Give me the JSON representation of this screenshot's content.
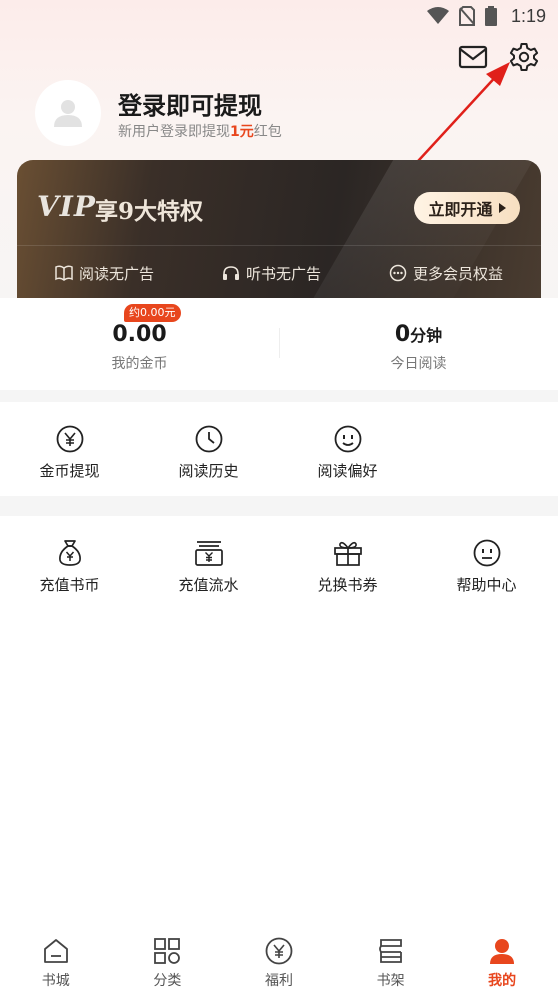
{
  "status_bar": {
    "time": "1:19",
    "icons": [
      "wifi-icon",
      "no-sim-icon",
      "battery-icon"
    ]
  },
  "header": {
    "icons": [
      "mail-icon",
      "settings-icon"
    ]
  },
  "profile": {
    "title": "登录即可提现",
    "subtitle_prefix": "新用户登录即提现",
    "subtitle_highlight": "1元",
    "subtitle_suffix": "红包"
  },
  "vip": {
    "logo": "VIP",
    "title": "享9大特权",
    "button_label": "立即开通",
    "benefits": [
      {
        "icon": "book-icon",
        "label": "阅读无广告"
      },
      {
        "icon": "headphones-icon",
        "label": "听书无广告"
      },
      {
        "icon": "more-icon",
        "label": "更多会员权益"
      }
    ]
  },
  "stats": {
    "coins": {
      "badge": "约0.00元",
      "value": "0.00",
      "label": "我的金币"
    },
    "reading": {
      "value": "0",
      "unit": "分钟",
      "label": "今日阅读"
    }
  },
  "grid1": [
    {
      "icon": "yuan-icon",
      "label": "金币提现"
    },
    {
      "icon": "clock-icon",
      "label": "阅读历史"
    },
    {
      "icon": "smile-icon",
      "label": "阅读偏好"
    }
  ],
  "grid2": [
    {
      "icon": "money-bag-icon",
      "label": "充值书币"
    },
    {
      "icon": "wallet-icon",
      "label": "充值流水"
    },
    {
      "icon": "gift-icon",
      "label": "兑换书券"
    },
    {
      "icon": "help-face-icon",
      "label": "帮助中心"
    }
  ],
  "bottom_nav": [
    {
      "icon": "home-icon",
      "label": "书城"
    },
    {
      "icon": "category-icon",
      "label": "分类"
    },
    {
      "icon": "welfare-icon",
      "label": "福利"
    },
    {
      "icon": "bookshelf-icon",
      "label": "书架"
    },
    {
      "icon": "profile-icon",
      "label": "我的",
      "active": true
    }
  ],
  "colors": {
    "accent": "#e8461d",
    "vip_bg": "#2b2624",
    "vip_text": "#efe6da"
  }
}
